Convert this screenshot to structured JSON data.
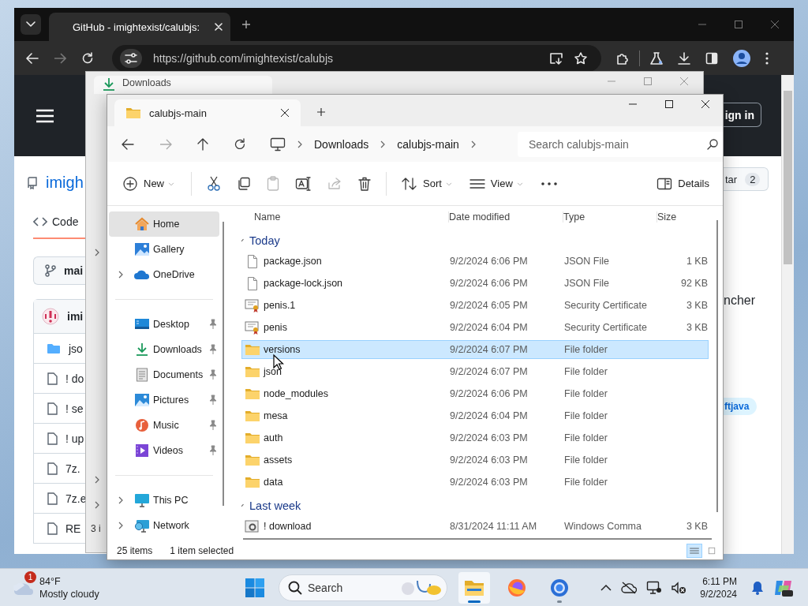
{
  "browser": {
    "tab_title": "GitHub - imightexist/calubjs:",
    "url": "https://github.com/imightexist/calubjs"
  },
  "github": {
    "repo": "imigh",
    "tab": "Code",
    "branch": "mai",
    "author": "imi",
    "files": [
      {
        "kind": "folder",
        "name": "jso"
      },
      {
        "kind": "file",
        "name": "! do"
      },
      {
        "kind": "file",
        "name": "! se"
      },
      {
        "kind": "file",
        "name": "! up"
      },
      {
        "kind": "file",
        "name": "7z."
      },
      {
        "kind": "file",
        "name": "7z.e"
      },
      {
        "kind": "file",
        "name": "RE"
      }
    ],
    "sign_in": "ign in",
    "star": "tar",
    "star_count": "2",
    "about": "ncher",
    "topic": "ftjava"
  },
  "downloads_window": {
    "tab_title": "Downloads",
    "status": "3 i"
  },
  "explorer": {
    "tab_title": "calubjs-main",
    "breadcrumb": [
      "Downloads",
      "calubjs-main"
    ],
    "search_placeholder": "Search calubjs-main",
    "toolbar": [
      [
        {
          "kind": "new",
          "label": "New",
          "disabled": false
        }
      ],
      [
        {
          "kind": "cut",
          "disabled": false
        },
        {
          "kind": "copy",
          "disabled": false
        },
        {
          "kind": "paste",
          "disabled": true
        },
        {
          "kind": "rename",
          "disabled": false
        },
        {
          "kind": "share",
          "disabled": true
        },
        {
          "kind": "delete",
          "disabled": false
        }
      ],
      [
        {
          "kind": "sort",
          "label": "Sort",
          "disabled": false
        },
        {
          "kind": "view",
          "label": "View",
          "disabled": false
        },
        {
          "kind": "more",
          "disabled": false
        }
      ]
    ],
    "details": "Details",
    "sidebar": [
      [
        {
          "kind": "home",
          "label": "Home",
          "selected": true,
          "expandable": false,
          "pinned": false
        },
        {
          "kind": "gallery",
          "label": "Gallery",
          "selected": false,
          "expandable": false,
          "pinned": false
        },
        {
          "kind": "cloud",
          "label": "OneDrive",
          "selected": false,
          "expandable": true,
          "pinned": false
        }
      ],
      [
        {
          "kind": "desktop",
          "label": "Desktop",
          "selected": false,
          "expandable": false,
          "pinned": true
        },
        {
          "kind": "downloads",
          "label": "Downloads",
          "selected": false,
          "expandable": false,
          "pinned": true
        },
        {
          "kind": "documents",
          "label": "Documents",
          "selected": false,
          "expandable": false,
          "pinned": true
        },
        {
          "kind": "pictures",
          "label": "Pictures",
          "selected": false,
          "expandable": false,
          "pinned": true
        },
        {
          "kind": "music",
          "label": "Music",
          "selected": false,
          "expandable": false,
          "pinned": true
        },
        {
          "kind": "videos",
          "label": "Videos",
          "selected": false,
          "expandable": false,
          "pinned": true
        }
      ],
      [
        {
          "kind": "pc",
          "label": "This PC",
          "selected": false,
          "expandable": true,
          "pinned": false
        },
        {
          "kind": "network",
          "label": "Network",
          "selected": false,
          "expandable": true,
          "pinned": false
        }
      ]
    ],
    "columns": [
      "Name",
      "Date modified",
      "Type",
      "Size"
    ],
    "groups": [
      {
        "label": "Today",
        "expanded": true,
        "rows": [
          {
            "kind": "json",
            "name": "package.json",
            "date": "9/2/2024 6:06 PM",
            "type": "JSON File",
            "size": "1 KB",
            "selected": false
          },
          {
            "kind": "json",
            "name": "package-lock.json",
            "date": "9/2/2024 6:06 PM",
            "type": "JSON File",
            "size": "92 KB",
            "selected": false
          },
          {
            "kind": "cert",
            "name": "penis.1",
            "date": "9/2/2024 6:05 PM",
            "type": "Security Certificate",
            "size": "3 KB",
            "selected": false
          },
          {
            "kind": "cert",
            "name": "penis",
            "date": "9/2/2024 6:04 PM",
            "type": "Security Certificate",
            "size": "3 KB",
            "selected": false
          },
          {
            "kind": "folder",
            "name": "versions",
            "date": "9/2/2024 6:07 PM",
            "type": "File folder",
            "selected": true
          },
          {
            "kind": "folder",
            "name": "json",
            "date": "9/2/2024 6:07 PM",
            "type": "File folder",
            "selected": false
          },
          {
            "kind": "folder",
            "name": "node_modules",
            "date": "9/2/2024 6:06 PM",
            "type": "File folder",
            "selected": false
          },
          {
            "kind": "folder",
            "name": "mesa",
            "date": "9/2/2024 6:04 PM",
            "type": "File folder",
            "selected": false
          },
          {
            "kind": "folder",
            "name": "auth",
            "date": "9/2/2024 6:03 PM",
            "type": "File folder",
            "selected": false
          },
          {
            "kind": "folder",
            "name": "assets",
            "date": "9/2/2024 6:03 PM",
            "type": "File folder",
            "selected": false
          },
          {
            "kind": "folder",
            "name": "data",
            "date": "9/2/2024 6:03 PM",
            "type": "File folder",
            "selected": false
          }
        ]
      },
      {
        "label": "Last week",
        "expanded": true,
        "rows": [
          {
            "kind": "cmd",
            "name": "! download",
            "date": "8/31/2024 11:11 AM",
            "type": "Windows Comma",
            "size": "3 KB",
            "selected": false
          }
        ]
      }
    ],
    "status": {
      "count": "25 items",
      "selection": "1 item selected"
    },
    "views": [
      {
        "kind": "details",
        "selected": true
      },
      {
        "kind": "tiles",
        "selected": false
      }
    ]
  },
  "taskbar": {
    "weather": {
      "badge": "1",
      "temp": "84°F",
      "condition": "Mostly cloudy"
    },
    "search_placeholder": "Search",
    "apps": [
      {
        "kind": "explorer",
        "running": true,
        "active": true
      },
      {
        "kind": "firefox",
        "running": false,
        "active": false
      },
      {
        "kind": "chrome",
        "running": true,
        "active": false
      }
    ],
    "time": "6:11 PM",
    "date": "9/2/2024"
  }
}
